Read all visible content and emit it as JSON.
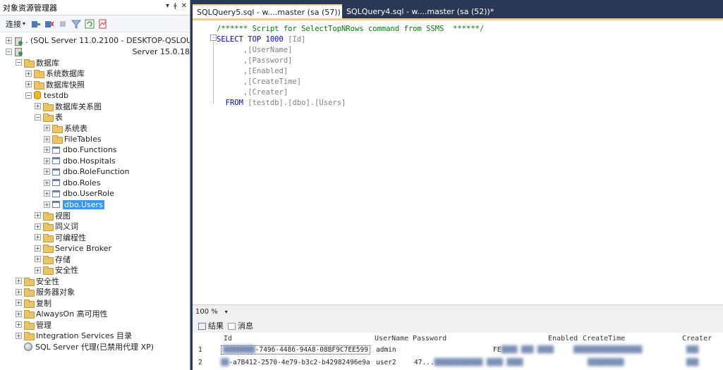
{
  "object_explorer": {
    "title": "对象资源管理器",
    "title_controls": [
      "▾",
      "ǂ",
      "✕"
    ],
    "toolbar_connect": "连接",
    "tree": [
      {
        "label": ". (SQL Server 11.0.2100 - DESKTOP-QSLOU5EY",
        "level": 0,
        "expander": "+",
        "icon": "server"
      },
      {
        "label": "Server 15.0.18",
        "level": 0,
        "expander": "-",
        "icon": "server",
        "right": true
      },
      {
        "label": "数据库",
        "level": 1,
        "expander": "-",
        "icon": "folder"
      },
      {
        "label": "系统数据库",
        "level": 2,
        "expander": "+",
        "icon": "folder"
      },
      {
        "label": "数据库快照",
        "level": 2,
        "expander": "+",
        "icon": "folder"
      },
      {
        "label": "testdb",
        "level": 2,
        "expander": "-",
        "icon": "db"
      },
      {
        "label": "数据库关系图",
        "level": 3,
        "expander": "+",
        "icon": "folder"
      },
      {
        "label": "表",
        "level": 3,
        "expander": "-",
        "icon": "folder"
      },
      {
        "label": "系统表",
        "level": 4,
        "expander": "+",
        "icon": "folder"
      },
      {
        "label": "FileTables",
        "level": 4,
        "expander": "+",
        "icon": "folder"
      },
      {
        "label": "dbo.Functions",
        "level": 4,
        "expander": "+",
        "icon": "table"
      },
      {
        "label": "dbo.Hospitals",
        "level": 4,
        "expander": "+",
        "icon": "table"
      },
      {
        "label": "dbo.RoleFunction",
        "level": 4,
        "expander": "+",
        "icon": "table"
      },
      {
        "label": "dbo.Roles",
        "level": 4,
        "expander": "+",
        "icon": "table"
      },
      {
        "label": "dbo.UserRole",
        "level": 4,
        "expander": "+",
        "icon": "table"
      },
      {
        "label": "dbo.Users",
        "level": 4,
        "expander": "+",
        "icon": "table",
        "selected": true
      },
      {
        "label": "视图",
        "level": 3,
        "expander": "+",
        "icon": "folder"
      },
      {
        "label": "同义词",
        "level": 3,
        "expander": "+",
        "icon": "folder"
      },
      {
        "label": "可编程性",
        "level": 3,
        "expander": "+",
        "icon": "folder"
      },
      {
        "label": "Service Broker",
        "level": 3,
        "expander": "+",
        "icon": "folder"
      },
      {
        "label": "存储",
        "level": 3,
        "expander": "+",
        "icon": "folder"
      },
      {
        "label": "安全性",
        "level": 3,
        "expander": "+",
        "icon": "folder"
      },
      {
        "label": "安全性",
        "level": 1,
        "expander": "+",
        "icon": "folder"
      },
      {
        "label": "服务器对象",
        "level": 1,
        "expander": "+",
        "icon": "folder"
      },
      {
        "label": "复制",
        "level": 1,
        "expander": "+",
        "icon": "folder"
      },
      {
        "label": "AlwaysOn 高可用性",
        "level": 1,
        "expander": "+",
        "icon": "folder"
      },
      {
        "label": "管理",
        "level": 1,
        "expander": "+",
        "icon": "folder"
      },
      {
        "label": "Integration Services 目录",
        "level": 1,
        "expander": "+",
        "icon": "folder"
      },
      {
        "label": "SQL Server 代理(已禁用代理 XP)",
        "level": 1,
        "expander": "",
        "icon": "agent"
      }
    ]
  },
  "tabs": {
    "active": "SQLQuery5.sql - w....master (sa (57))",
    "close": "✕",
    "inactive": "SQLQuery4.sql - w....master (sa (52))*"
  },
  "editor": {
    "collapse_glyph": "-",
    "lines": [
      [
        {
          "t": "/****** Script for SelectTopNRows command from SSMS  ******/",
          "c": "cm"
        }
      ],
      [
        {
          "t": "SELECT TOP 1000 ",
          "c": "kw"
        },
        {
          "t": "[Id]",
          "c": "br"
        }
      ],
      [
        {
          "t": "      ,",
          "c": "br"
        },
        {
          "t": "[UserName]",
          "c": "br"
        }
      ],
      [
        {
          "t": "      ,",
          "c": "br"
        },
        {
          "t": "[Password]",
          "c": "br"
        }
      ],
      [
        {
          "t": "      ,",
          "c": "br"
        },
        {
          "t": "[Enabled]",
          "c": "br"
        }
      ],
      [
        {
          "t": "      ,",
          "c": "br"
        },
        {
          "t": "[CreateTime]",
          "c": "br"
        }
      ],
      [
        {
          "t": "      ,",
          "c": "br"
        },
        {
          "t": "[Creater]",
          "c": "br"
        }
      ],
      [
        {
          "t": "  FROM ",
          "c": "kw"
        },
        {
          "t": "[testdb]",
          "c": "br"
        },
        {
          "t": ".",
          "c": "br"
        },
        {
          "t": "[dbo]",
          "c": "br"
        },
        {
          "t": ".",
          "c": "br"
        },
        {
          "t": "[Users]",
          "c": "br"
        }
      ]
    ]
  },
  "zoom": {
    "value": "100 %",
    "dropdown": "▾"
  },
  "results_tabs": {
    "results": "结果",
    "messages": "消息"
  },
  "grid": {
    "columns": [
      "Id",
      "UserName",
      "Password",
      "Enabled",
      "CreateTime",
      "Creater"
    ],
    "rows": [
      {
        "num": "1",
        "id": "-7496-4486-94A8-08BF9C7EE599",
        "username": "admin",
        "password": "FE"
      },
      {
        "num": "2",
        "id": "-a7B412-2570-4e79-b3c2-b42982496e9a",
        "username": "user2",
        "password": "47..."
      }
    ]
  },
  "colors": {
    "accent_tab": "#f5cc84",
    "frame": "#293955",
    "selection": "#3399ff"
  }
}
